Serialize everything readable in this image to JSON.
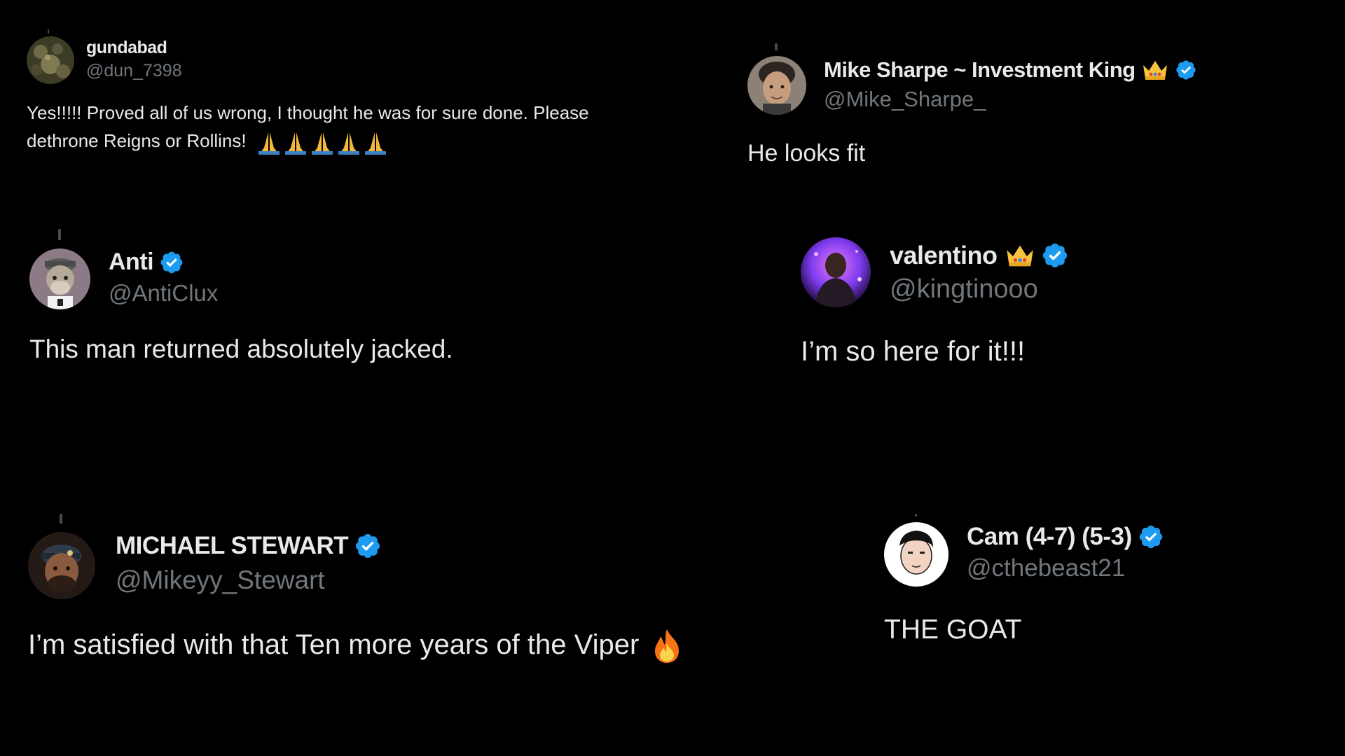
{
  "colors": {
    "background": "#000000",
    "name": "#e7e9ea",
    "handle": "#71767b",
    "verified": "#1d9bf0"
  },
  "tweets": [
    {
      "display_name": "gundabad",
      "handle": "@dun_7398",
      "text_line1": "Yes!!!!! Proved all of us wrong, I thought he was for sure done. Please",
      "text_line2": "dethrone Reigns or Rollins!",
      "verified": false,
      "emoji": "folded-hands-icon x5"
    },
    {
      "display_name": "Mike Sharpe ~ Investment King",
      "handle": "@Mike_Sharpe_",
      "text": "He looks fit",
      "verified": true,
      "emoji": "crown-icon"
    },
    {
      "display_name": "Anti",
      "handle": "@AntiClux",
      "text": "This man returned absolutely jacked.",
      "verified": true
    },
    {
      "display_name": "valentino",
      "handle": "@kingtinooo",
      "text": "I’m so here for it!!!",
      "verified": true,
      "emoji": "crown-icon"
    },
    {
      "display_name": "MICHAEL STEWART",
      "handle": "@Mikeyy_Stewart",
      "text": "I’m satisfied with that Ten more years of the Viper",
      "verified": true,
      "emoji": "fire-icon"
    },
    {
      "display_name": "Cam (4-7) (5-3)",
      "handle": "@cthebeast21",
      "text": "THE GOAT",
      "verified": true
    }
  ]
}
